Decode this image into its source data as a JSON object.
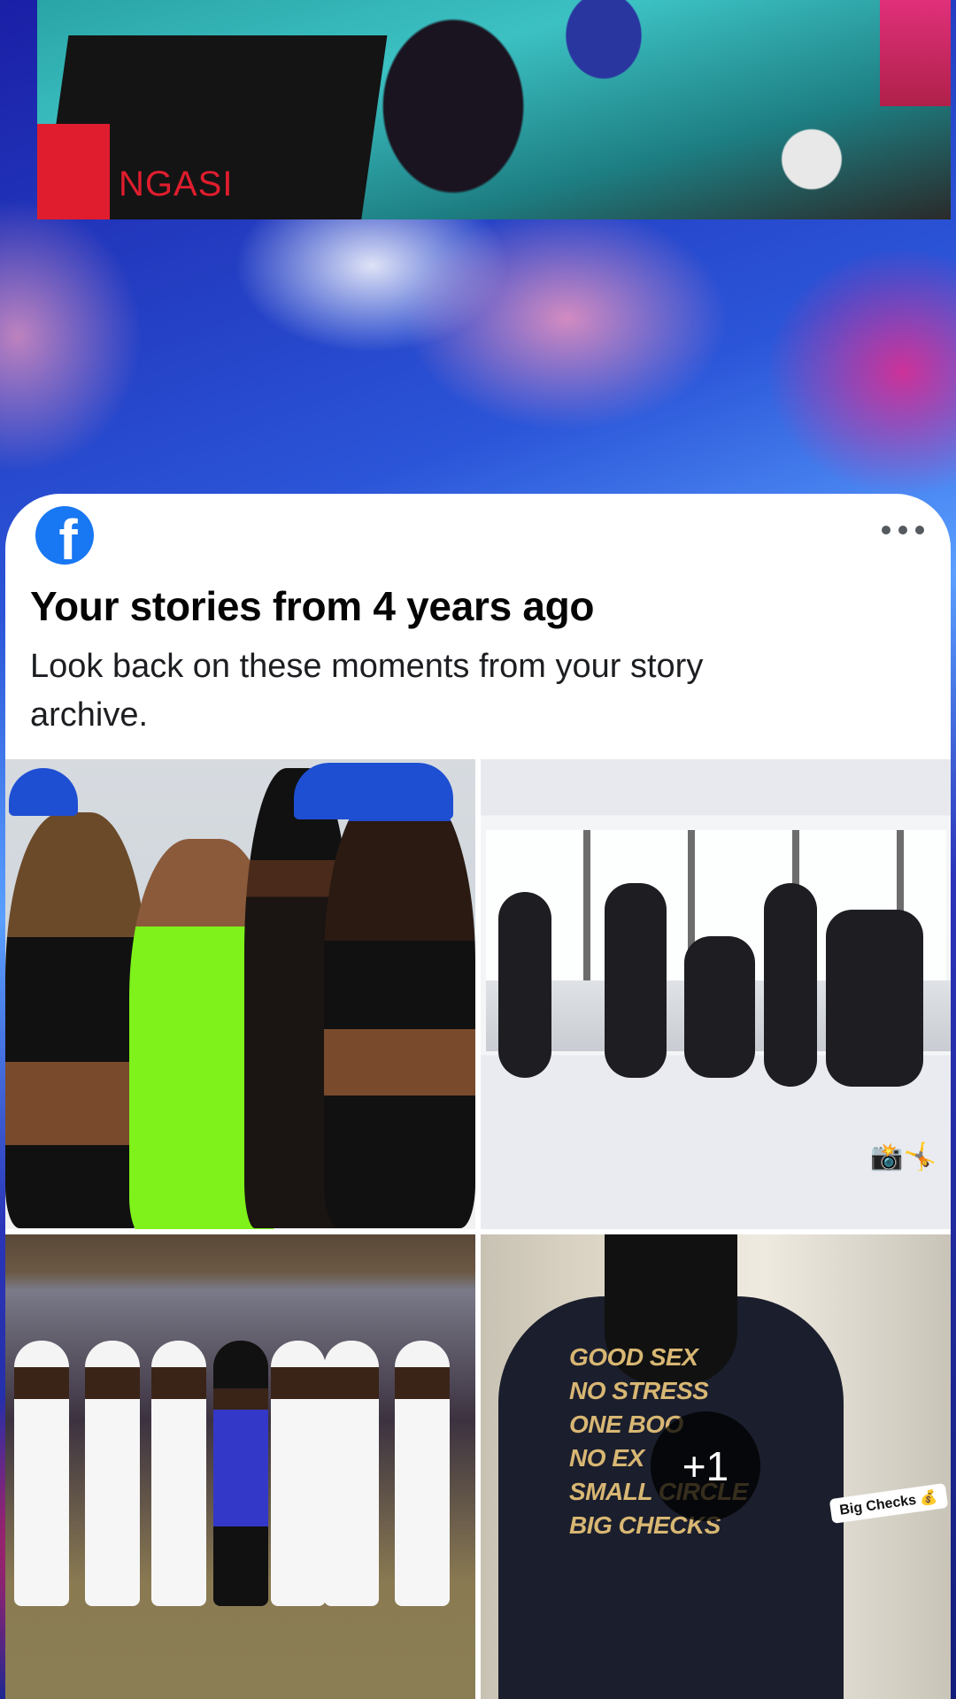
{
  "header": {
    "top_photo_caption": "NGASI"
  },
  "card": {
    "app_logo_letter": "f",
    "title": "Your stories from 4 years ago",
    "subtitle": "Look back on these moments from your story archive.",
    "photos": [
      {
        "id": "photo-1"
      },
      {
        "id": "photo-2",
        "emoji": "📸🤸"
      },
      {
        "id": "photo-3"
      },
      {
        "id": "photo-4",
        "more_count": "+1",
        "shirt_text": "GOOD SEX\nNO STRESS\nONE BOO\nNO EX\nSMALL CIRCLE\nBIG CHECKS",
        "sticker": "Big Checks 💰"
      }
    ]
  },
  "colors": {
    "facebook_blue": "#1877f2",
    "card_background": "#ffffff",
    "title_text": "#050505"
  },
  "icons": [
    "facebook-logo-icon",
    "more-options-icon"
  ]
}
